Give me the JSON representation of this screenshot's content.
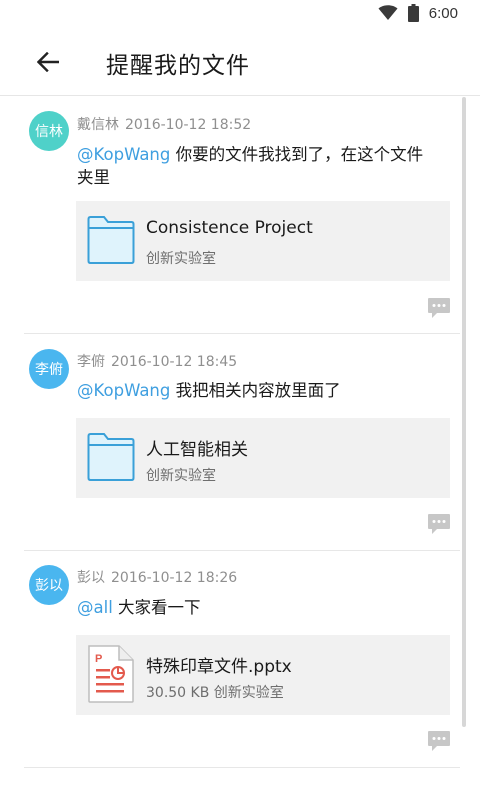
{
  "status_bar": {
    "time": "6:00"
  },
  "header": {
    "title": "提醒我的文件"
  },
  "posts": [
    {
      "avatar_text": "信林",
      "avatar_color": "#4fd1c9",
      "author": "戴信林",
      "timestamp": "2016-10-12 18:52",
      "mention": "@KopWang",
      "message_line1": " 你要的文件我找到了，在这个文件",
      "message_line2": "夹里",
      "file": {
        "name": "Consistence Project",
        "meta": "创新实验室",
        "type": "folder"
      }
    },
    {
      "avatar_text": "李俯",
      "avatar_color": "#4ab6ef",
      "author": "李俯",
      "timestamp": "2016-10-12 18:45",
      "mention": "@KopWang",
      "message_line1": " 我把相关内容放里面了",
      "message_line2": "",
      "file": {
        "name": "人工智能相关",
        "meta": "创新实验室",
        "type": "folder"
      }
    },
    {
      "avatar_text": "彭以",
      "avatar_color": "#4ab6ef",
      "author": "彭以",
      "timestamp": "2016-10-12 18:26",
      "mention": "@all",
      "message_line1": " 大家看一下",
      "message_line2": "",
      "file": {
        "name": "特殊印章文件.pptx",
        "meta": "30.50 KB  创新实验室",
        "type": "pptx"
      }
    }
  ],
  "colors": {
    "accent": "#3f9fe0",
    "folder_stroke": "#3aa0d8",
    "folder_fill": "#dff3fc",
    "pptx_red": "#e35a4d",
    "comment_icon": "#c7c7c7"
  },
  "icons": {
    "back": "arrow-left-icon",
    "wifi": "wifi-icon",
    "battery": "battery-icon",
    "folder": "folder-icon",
    "pptx": "pptx-file-icon",
    "comment": "comment-icon"
  }
}
